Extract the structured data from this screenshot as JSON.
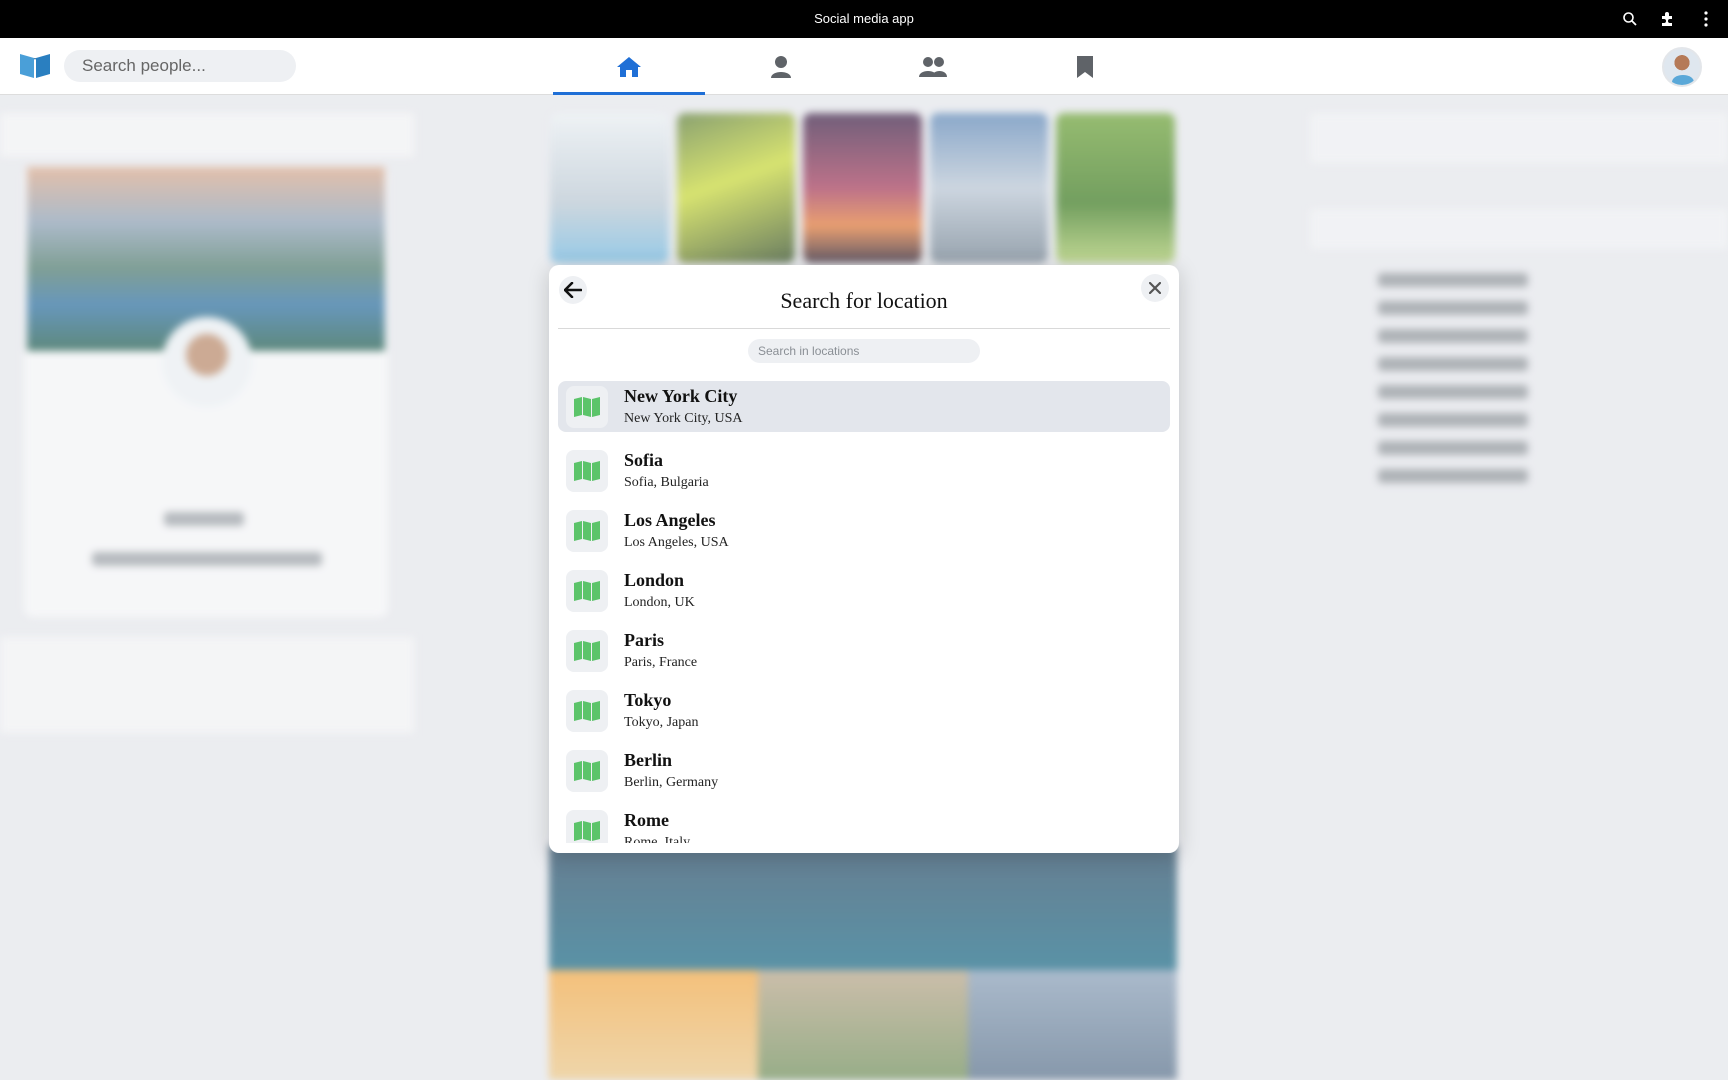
{
  "window": {
    "title": "Social media app"
  },
  "header": {
    "search_placeholder": "Search people..."
  },
  "modal": {
    "title": "Search for location",
    "search_placeholder": "Search in locations",
    "locations": [
      {
        "name": "New York City",
        "detail": "New York City, USA",
        "selected": true
      },
      {
        "name": "Sofia",
        "detail": "Sofia, Bulgaria"
      },
      {
        "name": "Los Angeles",
        "detail": "Los Angeles, USA"
      },
      {
        "name": "London",
        "detail": "London, UK"
      },
      {
        "name": "Paris",
        "detail": "Paris, France"
      },
      {
        "name": "Tokyo",
        "detail": "Tokyo, Japan"
      },
      {
        "name": "Berlin",
        "detail": "Berlin, Germany"
      },
      {
        "name": "Rome",
        "detail": "Rome, Italy"
      }
    ]
  },
  "colors": {
    "accent": "#1f6fd6",
    "map_icon": "#5cc46a",
    "selected_row": "#e3e6ec"
  }
}
